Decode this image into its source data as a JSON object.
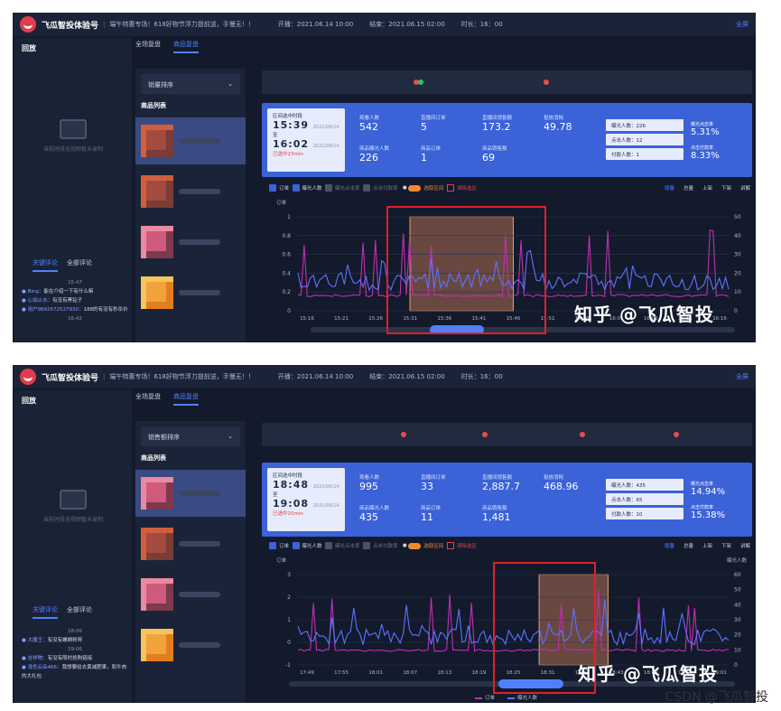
{
  "header": {
    "brand": "飞瓜智投体验号",
    "separator": "|",
    "subtitle": "端午特惠专场！618好物节浮力提前送，手慢无！！",
    "start": "开播：2021.06.14 10:00",
    "fullscreen": "全屏"
  },
  "screens": [
    {
      "end": "结束：2021.06.15 02:00",
      "duration": "时长：16：00",
      "left": {
        "title": "回放",
        "empty_text": "当前时段无视频暂未录制",
        "tabs": [
          "关键评论",
          "全部评论"
        ],
        "comments": [
          {
            "type": "time",
            "text": "15:47"
          },
          {
            "type": "comment",
            "user": "Bing",
            "text": "能在介绍一下有什么嘛"
          },
          {
            "type": "comment",
            "user": "心如止水",
            "text": "有没有黑钻子"
          },
          {
            "type": "comment",
            "user": "用户9892672527930",
            "text": "188的有没有秒杀价"
          },
          {
            "type": "time",
            "text": "16:42"
          }
        ]
      },
      "tabs": [
        "全场复盘",
        "商品复盘"
      ],
      "sort_label": "销量排序",
      "product_list_title": "商品列表",
      "stats": {
        "range_title": "区间选中时段",
        "start_time": "15:39",
        "start_date": "2021/06/14",
        "to": "至",
        "end_time": "16:02",
        "end_date": "2021/06/14",
        "selected": "已选中23min",
        "metrics": [
          {
            "label": "观看人数",
            "value": "542"
          },
          {
            "label": "直播间订单",
            "value": "5"
          },
          {
            "label": "直播间销售额",
            "value": "173.2"
          },
          {
            "label": "投放消耗",
            "value": "49.78"
          },
          {
            "label": "商品曝光人数",
            "value": "226"
          },
          {
            "label": "商品订单",
            "value": "1"
          },
          {
            "label": "商品销售额",
            "value": "69"
          }
        ],
        "boxes": [
          "曝光人数：226",
          "点击人数：12",
          "付款人数：1"
        ],
        "rates": [
          {
            "label": "曝光点击率",
            "value": "5.31%"
          },
          {
            "label": "点击付款率",
            "value": "8.33%"
          }
        ]
      },
      "filters": [
        "订单",
        "曝光人数",
        "曝光点击率",
        "点击付款率"
      ],
      "toggle_label": "选取区间",
      "clear_label": "清除选区",
      "right_legend": [
        "增量",
        "总量",
        "上架",
        "下架",
        "讲解"
      ],
      "left_axis_title": "订单",
      "chart_data": {
        "type": "line",
        "x": [
          "15:16",
          "15:21",
          "15:26",
          "15:31",
          "15:36",
          "15:41",
          "15:46",
          "15:51",
          "15:56",
          "16:01",
          "16:06",
          "16:11",
          "16:16"
        ],
        "y_left_ticks": [
          "1",
          "0.8",
          "0.6",
          "0.4",
          "0.2",
          "0"
        ],
        "y_right_ticks": [
          "50",
          "40",
          "30",
          "20",
          "10",
          "0"
        ],
        "ylim_left": [
          0,
          1
        ],
        "ylim_right": [
          0,
          50
        ],
        "series": [
          {
            "name": "订单",
            "color": "#c030b0"
          },
          {
            "name": "曝光人数",
            "color": "#5b74ff"
          }
        ]
      },
      "watermark": "知乎 @飞瓜智投"
    },
    {
      "end": "结束：2021.06.15 02:00",
      "duration": "时长：16：00",
      "left": {
        "title": "回放",
        "empty_text": "当前时段无视频暂未录制",
        "tabs": [
          "关键评论",
          "全部评论"
        ],
        "comments": [
          {
            "type": "time",
            "text": "18:06"
          },
          {
            "type": "comment",
            "user": "大魔王",
            "text": "有没有螺蛳粉呀"
          },
          {
            "type": "time",
            "text": "19:06"
          },
          {
            "type": "comment",
            "user": "吉祥物",
            "text": "有没有限时抢购链接"
          },
          {
            "type": "comment",
            "user": "浅色云朵466",
            "text": "我想要给去黄减肥果，和牛肉的大礼包"
          }
        ]
      },
      "tabs": [
        "全场复盘",
        "商品复盘"
      ],
      "sort_label": "销售额排序",
      "product_list_title": "商品列表",
      "stats": {
        "range_title": "区间选中时段",
        "start_time": "18:48",
        "start_date": "2021/06/14",
        "to": "至",
        "end_time": "19:08",
        "end_date": "2021/06/14",
        "selected": "已选中20min",
        "metrics": [
          {
            "label": "观看人数",
            "value": "995"
          },
          {
            "label": "直播间订单",
            "value": "33"
          },
          {
            "label": "直播间销售额",
            "value": "2,887.7"
          },
          {
            "label": "投放消耗",
            "value": "468.96"
          },
          {
            "label": "商品曝光人数",
            "value": "435"
          },
          {
            "label": "商品订单",
            "value": "11"
          },
          {
            "label": "商品销售额",
            "value": "1,481"
          }
        ],
        "boxes": [
          "曝光人数：435",
          "点击人数：65",
          "付款人数：10"
        ],
        "rates": [
          {
            "label": "曝光点击率",
            "value": "14.94%"
          },
          {
            "label": "点击付款率",
            "value": "15.38%"
          }
        ]
      },
      "filters": [
        "订单",
        "曝光人数",
        "曝光点击率",
        "点击付款率"
      ],
      "toggle_label": "选取区间",
      "clear_label": "清除选区",
      "right_legend": [
        "增量",
        "总量",
        "上架",
        "下架",
        "讲解"
      ],
      "left_axis_title": "订单",
      "right_axis_title": "曝光人数",
      "legend": [
        "订单",
        "曝光人数"
      ],
      "chart_data": {
        "type": "line",
        "x": [
          "17:49",
          "17:55",
          "18:01",
          "18:07",
          "18:13",
          "18:19",
          "18:25",
          "18:31",
          "18:37",
          "18:43",
          "18:49",
          "18:55",
          "19:01"
        ],
        "y_left_ticks": [
          "3",
          "2",
          "1",
          "0",
          "-1"
        ],
        "y_right_ticks": [
          "60",
          "50",
          "40",
          "30",
          "20",
          "10",
          "0"
        ],
        "ylim_left": [
          -1,
          3
        ],
        "ylim_right": [
          0,
          60
        ],
        "series": [
          {
            "name": "订单",
            "color": "#c030b0"
          },
          {
            "name": "曝光人数",
            "color": "#5b74ff"
          }
        ]
      },
      "watermark": "知乎 @飞瓜智投"
    }
  ],
  "credit": "CSDN @飞瓜智投"
}
